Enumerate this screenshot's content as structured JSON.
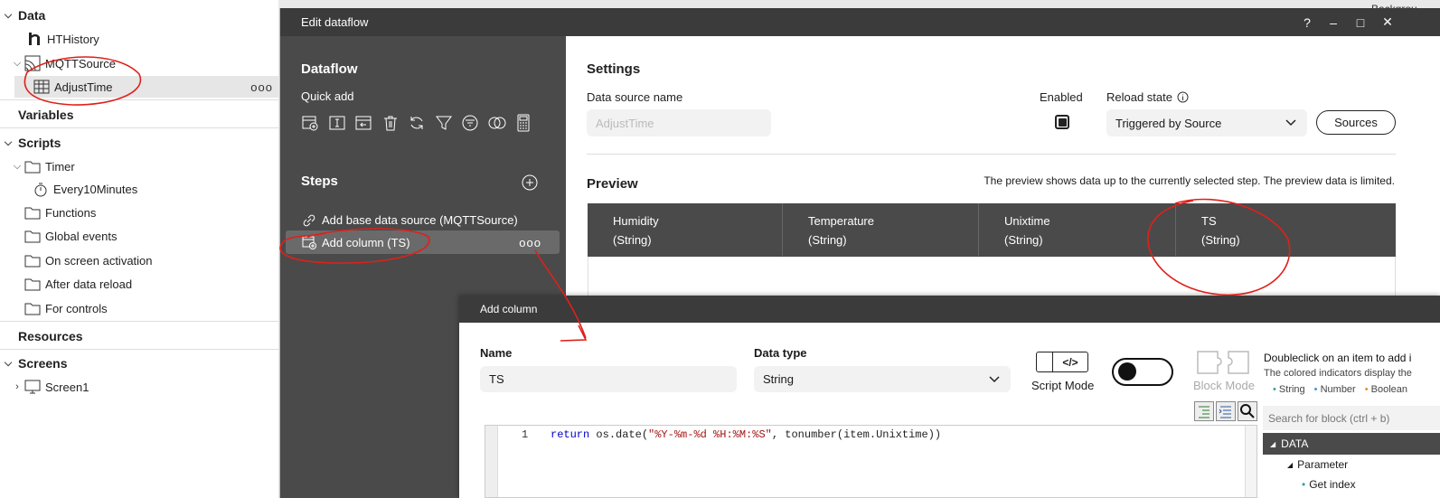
{
  "tree": {
    "data_label": "Data",
    "hthistory": "HTHistory",
    "mqttsource": "MQTTSource",
    "adjusttime": "AdjustTime",
    "variables": "Variables",
    "scripts": "Scripts",
    "timer": "Timer",
    "every10": "Every10Minutes",
    "functions": "Functions",
    "global_events": "Global events",
    "on_screen": "On screen activation",
    "after_reload": "After data reload",
    "for_controls": "For controls",
    "resources": "Resources",
    "screens": "Screens",
    "screen1": "Screen1",
    "more": "ooo"
  },
  "bg_title_partial": "Backgrou",
  "edit_dialog": {
    "title": "Edit dataflow",
    "help": "?",
    "minimize": "–",
    "maximize": "□",
    "close": "✕",
    "dataflow_heading": "Dataflow",
    "quick_add": "Quick add",
    "quick_add_icons": [
      "add-column-icon",
      "text-cursor-icon",
      "import-icon",
      "trash-icon",
      "refresh-icon",
      "filter-icon",
      "list-filter-icon",
      "join-icon",
      "calculator-icon"
    ],
    "steps_heading": "Steps",
    "steps": [
      {
        "label": "Add base data source (MQTTSource)",
        "icon": "link-icon"
      },
      {
        "label": "Add column (TS)",
        "icon": "add-column-icon",
        "more": "ooo"
      }
    ],
    "settings": {
      "heading": "Settings",
      "ds_name_label": "Data source name",
      "ds_name_placeholder": "AdjustTime",
      "enabled_label": "Enabled",
      "enabled": true,
      "reload_label": "Reload state",
      "reload_value": "Triggered by Source",
      "sources_button": "Sources"
    },
    "preview": {
      "heading": "Preview",
      "note": "The preview shows data up to the currently selected step. The preview data is limited.",
      "columns": [
        {
          "name": "Humidity",
          "type": "(String)"
        },
        {
          "name": "Temperature",
          "type": "(String)"
        },
        {
          "name": "Unixtime",
          "type": "(String)"
        },
        {
          "name": "TS",
          "type": "(String)"
        }
      ]
    }
  },
  "add_dialog": {
    "title": "Add column",
    "name_label": "Name",
    "name_value": "TS",
    "type_label": "Data type",
    "type_value": "String",
    "script_mode": "Script Mode",
    "block_mode": "Block Mode",
    "script_icon": "</>",
    "help_title": "Doubleclick on an item to add i",
    "help_sub": "The colored indicators display the",
    "legend": [
      "String",
      "Number",
      "Boolean"
    ],
    "legend_colors": [
      "#3aa0a0",
      "#4a90c8",
      "#e0902a"
    ],
    "search_placeholder": "Search for block (ctrl + b)",
    "code_line_number": "1",
    "code": {
      "kw": "return",
      "pre": " os.date(",
      "str": "\"%Y-%m-%d %H:%M:%S\"",
      "post": ", tonumber(item.Unixtime))"
    },
    "block_tree": {
      "data": "DATA",
      "parameter": "Parameter",
      "get_index": "Get index"
    }
  },
  "annotation_color": "#e0201a"
}
